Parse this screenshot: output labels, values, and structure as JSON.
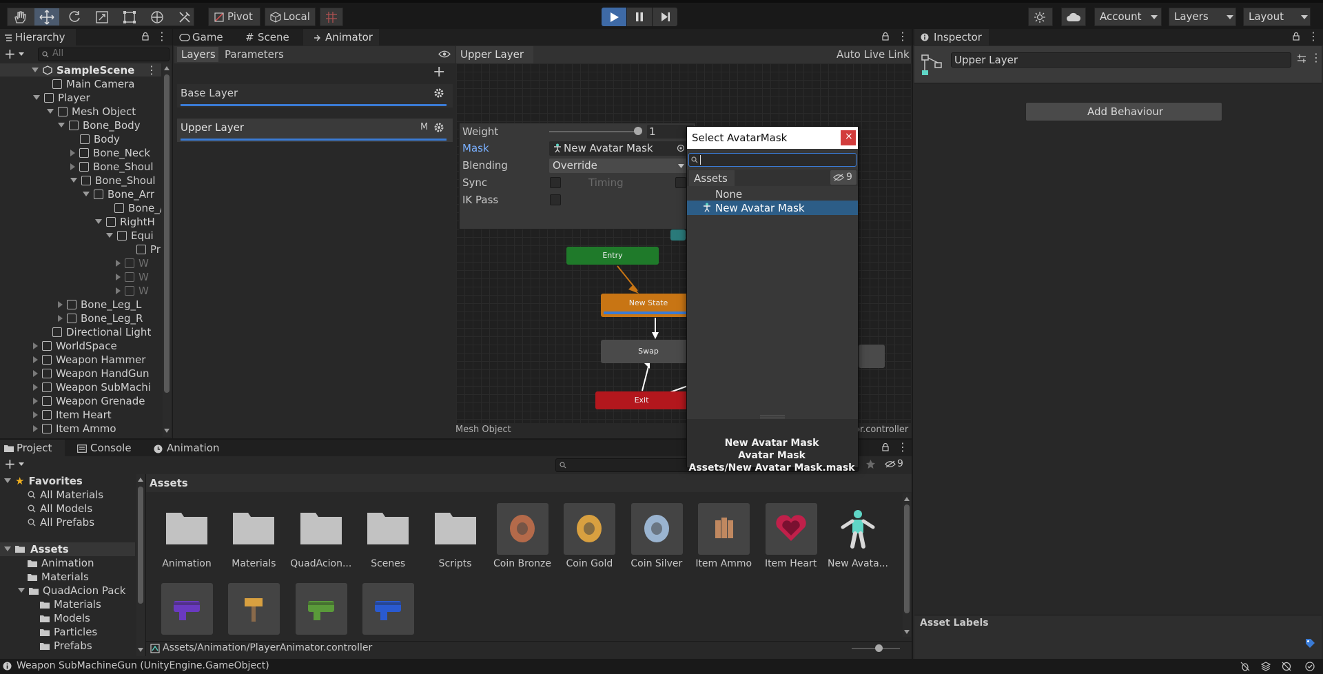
{
  "toolbar": {
    "pivot_label": "Pivot",
    "local_label": "Local",
    "account_label": "Account",
    "layers_label": "Layers",
    "layout_label": "Layout"
  },
  "hierarchy": {
    "tab_label": "Hierarchy",
    "search_placeholder": "All",
    "scene_name": "SampleScene",
    "items": [
      {
        "label": "Main Camera"
      },
      {
        "label": "Player"
      },
      {
        "label": "Mesh Object"
      },
      {
        "label": "Bone_Body"
      },
      {
        "label": "Body"
      },
      {
        "label": "Bone_Neck"
      },
      {
        "label": "Bone_Shoul"
      },
      {
        "label": "Bone_Shoul"
      },
      {
        "label": "Bone_Arr"
      },
      {
        "label": "Bone_/"
      },
      {
        "label": "RightH"
      },
      {
        "label": "Equi"
      },
      {
        "label": "Pr"
      },
      {
        "label": "W"
      },
      {
        "label": "W"
      },
      {
        "label": "W"
      },
      {
        "label": "Bone_Leg_L"
      },
      {
        "label": "Bone_Leg_R"
      },
      {
        "label": "Directional Light"
      },
      {
        "label": "WorldSpace"
      },
      {
        "label": "Weapon Hammer"
      },
      {
        "label": "Weapon HandGun"
      },
      {
        "label": "Weapon SubMachi"
      },
      {
        "label": "Weapon Grenade"
      },
      {
        "label": "Item Heart"
      },
      {
        "label": "Item Ammo"
      }
    ]
  },
  "center_tabs": {
    "game": "Game",
    "scene": "Scene",
    "animator": "Animator"
  },
  "animator": {
    "layers_tab": "Layers",
    "parameters_tab": "Parameters",
    "breadcrumb": "Upper Layer",
    "auto_live_link": "Auto Live Link",
    "base_layer": "Base Layer",
    "upper_layer": "Upper Layer",
    "upper_layer_badge": "M",
    "footer_left": "Mesh Object",
    "footer_right": "or.controller",
    "settings": {
      "weight_label": "Weight",
      "weight_value": "1",
      "weight_fraction": 1.0,
      "mask_label": "Mask",
      "mask_value": "New Avatar Mask",
      "blending_label": "Blending",
      "blending_value": "Override",
      "sync_label": "Sync",
      "timing_label": "Timing",
      "ikpass_label": "IK Pass"
    },
    "nodes": {
      "entry": "Entry",
      "new_state": "New State",
      "swap": "Swap",
      "exit": "Exit"
    }
  },
  "picker": {
    "title": "Select AvatarMask",
    "search_value": "",
    "tab_assets": "Assets",
    "hidden_count": "9",
    "items": [
      {
        "label": "None"
      },
      {
        "label": "New Avatar Mask"
      }
    ],
    "preview_name": "New Avatar Mask",
    "preview_type": "Avatar Mask",
    "preview_path": "Assets/New Avatar Mask.mask"
  },
  "inspector": {
    "tab_label": "Inspector",
    "object_name": "Upper Layer",
    "add_behaviour": "Add Behaviour",
    "asset_labels": "Asset Labels"
  },
  "bottom_tabs": {
    "project": "Project",
    "console": "Console",
    "animation": "Animation"
  },
  "project": {
    "hidden_count": "9",
    "favorites_label": "Favorites",
    "favorites": [
      "All Materials",
      "All Models",
      "All Prefabs"
    ],
    "assets_root": "Assets",
    "tree": [
      {
        "label": "Animation"
      },
      {
        "label": "Materials"
      },
      {
        "label": "QuadAcion Pack"
      },
      {
        "label": "Materials"
      },
      {
        "label": "Models"
      },
      {
        "label": "Particles"
      },
      {
        "label": "Prefabs"
      }
    ],
    "breadcrumb": "Assets",
    "grid_items": [
      {
        "label": "Animation",
        "kind": "folder"
      },
      {
        "label": "Materials",
        "kind": "folder"
      },
      {
        "label": "QuadAcion...",
        "kind": "folder"
      },
      {
        "label": "Scenes",
        "kind": "folder"
      },
      {
        "label": "Scripts",
        "kind": "folder"
      },
      {
        "label": "Coin Bronze",
        "kind": "coin",
        "color": "#b46a4a"
      },
      {
        "label": "Coin Gold",
        "kind": "coin",
        "color": "#d8a040"
      },
      {
        "label": "Coin Silver",
        "kind": "coin",
        "color": "#9ab4d0"
      },
      {
        "label": "Item Ammo",
        "kind": "ammo",
        "color": "#c08860"
      },
      {
        "label": "Item Heart",
        "kind": "heart",
        "color": "#c0204a"
      },
      {
        "label": "New Avata...",
        "kind": "avatar",
        "color": "#5fd6c6"
      }
    ],
    "grid_row2": [
      {
        "kind": "weapon",
        "color": "#6a3ac0"
      },
      {
        "kind": "hammer",
        "color": "#d8a040"
      },
      {
        "kind": "gun",
        "color": "#5a9a3a"
      },
      {
        "kind": "gun",
        "color": "#2a5ad0"
      }
    ],
    "footer_path": "Assets/Animation/PlayerAnimator.controller",
    "zoom_fraction": 0.6
  },
  "status_bar": {
    "message": "Weapon SubMachineGun (UnityEngine.GameObject)"
  },
  "colors": {
    "accent_blue": "#3a7bd5",
    "selection": "#2c5d87",
    "entry_green": "#1f7a2a",
    "state_orange": "#c87514",
    "exit_red": "#b3171d"
  }
}
